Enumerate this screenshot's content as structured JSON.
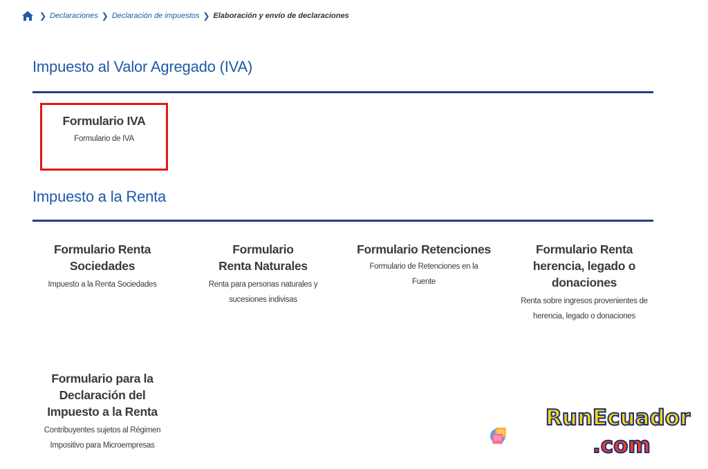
{
  "breadcrumb": {
    "items": [
      "Declaraciones",
      "Declaración de impuestos"
    ],
    "current": "Elaboración y envío de declaraciones"
  },
  "sections": [
    {
      "title": "Impuesto al Valor Agregado (IVA)",
      "cards": [
        {
          "title": "Formulario IVA",
          "description": "Formulario de IVA"
        }
      ]
    },
    {
      "title": "Impuesto a la Renta",
      "cards": [
        {
          "title": "Formulario Renta Sociedades",
          "description": "Impuesto a la Renta Sociedades"
        },
        {
          "title": "Formulario Renta Naturales",
          "description": "Renta para personas naturales y sucesiones indivisas"
        },
        {
          "title": "Formulario Retenciones",
          "description": "Formulario de Retenciones en la Fuente"
        },
        {
          "title": "Formulario Renta herencia, legado o donaciones",
          "description": "Renta sobre ingresos provenientes de herencia, legado o donaciones"
        },
        {
          "title": "Formulario para la Declaración del Impuesto a la Renta",
          "description": "Contribuyentes sujetos al Régimen Impositivo para Microempresas"
        }
      ]
    }
  ],
  "watermark": {
    "line1": "RunEcuador",
    "line2": ".com"
  },
  "colors": {
    "accent": "#1e5aa8",
    "rule": "#1e3f8a",
    "highlight": "#e3141b"
  }
}
